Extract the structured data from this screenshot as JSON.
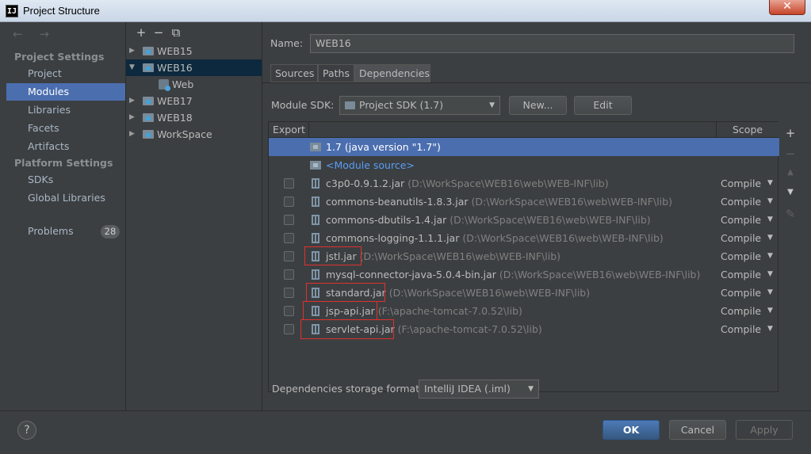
{
  "window": {
    "title": "Project Structure",
    "app_icon": "IJ",
    "close_glyph": "✕"
  },
  "nav": {
    "back_forward": "← →",
    "project_settings_header": "Project Settings",
    "platform_settings_header": "Platform Settings",
    "items": [
      {
        "label": "Project"
      },
      {
        "label": "Modules",
        "selected": true
      },
      {
        "label": "Libraries"
      },
      {
        "label": "Facets"
      },
      {
        "label": "Artifacts"
      },
      {
        "label": "SDKs"
      },
      {
        "label": "Global Libraries"
      },
      {
        "label": "Problems"
      }
    ],
    "problems_count": "28"
  },
  "tree": {
    "toolbar": {
      "add": "+",
      "remove": "−",
      "copy": "⧉"
    },
    "nodes": [
      {
        "label": "WEB15",
        "expanded": false
      },
      {
        "label": "WEB16",
        "expanded": true,
        "selected": true
      },
      {
        "label": "Web",
        "child": true
      },
      {
        "label": "WEB17",
        "expanded": false
      },
      {
        "label": "WEB18",
        "expanded": false
      },
      {
        "label": "WorkSpace",
        "expanded": false
      }
    ]
  },
  "module": {
    "name_label": "Name:",
    "name_value": "WEB16",
    "tabs": [
      "Sources",
      "Paths",
      "Dependencies"
    ],
    "active_tab": "Dependencies",
    "sdk_label": "Module SDK:",
    "sdk_value": "Project SDK (1.7)",
    "new_button": "New...",
    "edit_button": "Edit"
  },
  "dependencies": {
    "col_export": "Export",
    "col_scope": "Scope",
    "rows": [
      {
        "name": "1.7 (java version \"1.7\")",
        "path": "",
        "scope": "",
        "kind": "sdk",
        "selected": true
      },
      {
        "name": "<Module source>",
        "path": "",
        "scope": "",
        "kind": "source"
      },
      {
        "name": "c3p0-0.9.1.2.jar",
        "path": "(D:\\WorkSpace\\WEB16\\web\\WEB-INF\\lib)",
        "scope": "Compile",
        "kind": "jar"
      },
      {
        "name": "commons-beanutils-1.8.3.jar",
        "path": "(D:\\WorkSpace\\WEB16\\web\\WEB-INF\\lib)",
        "scope": "Compile",
        "kind": "jar"
      },
      {
        "name": "commons-dbutils-1.4.jar",
        "path": "(D:\\WorkSpace\\WEB16\\web\\WEB-INF\\lib)",
        "scope": "Compile",
        "kind": "jar"
      },
      {
        "name": "commons-logging-1.1.1.jar",
        "path": "(D:\\WorkSpace\\WEB16\\web\\WEB-INF\\lib)",
        "scope": "Compile",
        "kind": "jar"
      },
      {
        "name": "jstl.jar",
        "path": "(D:\\WorkSpace\\WEB16\\web\\WEB-INF\\lib)",
        "scope": "Compile",
        "kind": "jar",
        "highlighted": true
      },
      {
        "name": "mysql-connector-java-5.0.4-bin.jar",
        "path": "(D:\\WorkSpace\\WEB16\\web\\WEB-INF\\lib)",
        "scope": "Compile",
        "kind": "jar"
      },
      {
        "name": "standard.jar",
        "path": "(D:\\WorkSpace\\WEB16\\web\\WEB-INF\\lib)",
        "scope": "Compile",
        "kind": "jar",
        "highlighted": true
      },
      {
        "name": "jsp-api.jar",
        "path": "(F:\\apache-tomcat-7.0.52\\lib)",
        "scope": "Compile",
        "kind": "jar",
        "highlighted": true
      },
      {
        "name": "servlet-api.jar",
        "path": "(F:\\apache-tomcat-7.0.52\\lib)",
        "scope": "Compile",
        "kind": "jar",
        "highlighted": true
      }
    ],
    "side_tools": {
      "add": "+",
      "remove": "−",
      "up": "▲",
      "down": "▼",
      "edit": "✎"
    },
    "storage_label": "Dependencies storage format:",
    "storage_value": "IntelliJ IDEA (.iml)"
  },
  "footer": {
    "help": "?",
    "ok": "OK",
    "cancel": "Cancel",
    "apply": "Apply"
  },
  "colors": {
    "background": "#3c3f41",
    "selection": "#4b6eaf",
    "highlight_box": "#e03030"
  }
}
